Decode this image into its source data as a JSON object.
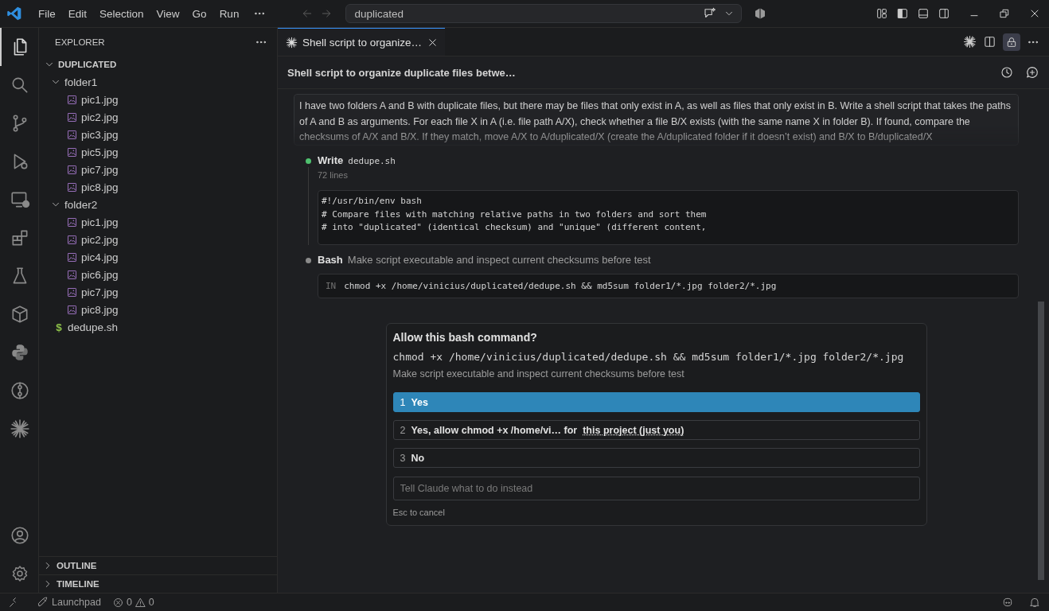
{
  "menu": [
    "File",
    "Edit",
    "Selection",
    "View",
    "Go",
    "Run"
  ],
  "command_center": {
    "text": "duplicated"
  },
  "activity_bar": [
    {
      "selected": true
    },
    {
      "selected": false
    },
    {
      "selected": false
    },
    {
      "selected": false
    },
    {
      "selected": false
    },
    {
      "selected": false
    },
    {
      "selected": false
    },
    {
      "selected": false
    },
    {
      "selected": false
    },
    {
      "selected": false
    },
    {
      "selected": false
    }
  ],
  "explorer": {
    "title": "EXPLORER",
    "tree": [
      {
        "label": "DUPLICATED",
        "kind": "root",
        "expanded": true,
        "children": [
          {
            "label": "folder1",
            "kind": "folder",
            "expanded": true,
            "children": [
              {
                "label": "pic1.jpg",
                "kind": "image"
              },
              {
                "label": "pic2.jpg",
                "kind": "image"
              },
              {
                "label": "pic3.jpg",
                "kind": "image"
              },
              {
                "label": "pic5.jpg",
                "kind": "image"
              },
              {
                "label": "pic7.jpg",
                "kind": "image"
              },
              {
                "label": "pic8.jpg",
                "kind": "image"
              }
            ]
          },
          {
            "label": "folder2",
            "kind": "folder",
            "expanded": true,
            "children": [
              {
                "label": "pic1.jpg",
                "kind": "image"
              },
              {
                "label": "pic2.jpg",
                "kind": "image"
              },
              {
                "label": "pic4.jpg",
                "kind": "image"
              },
              {
                "label": "pic6.jpg",
                "kind": "image"
              },
              {
                "label": "pic7.jpg",
                "kind": "image"
              },
              {
                "label": "pic8.jpg",
                "kind": "image"
              }
            ]
          },
          {
            "label": "dedupe.sh",
            "kind": "shell",
            "icon": "$"
          }
        ]
      }
    ],
    "sections": [
      {
        "label": "OUTLINE",
        "expanded": false
      },
      {
        "label": "TIMELINE",
        "expanded": false
      }
    ]
  },
  "tab": {
    "label": "Shell script to organize…",
    "selected": true
  },
  "chat": {
    "title": "Shell script to organize duplicate files betwe…",
    "prompt": "I have two folders A and B with duplicate files, but there may be files that only exist in A, as well as files that only exist in B. Write a shell script that takes the paths of A and B as arguments. For each file X in A (i.e. file path A/X), check whether a file B/X exists (with the same name X in folder B). If found, compare the checksums of A/X and B/X. If they match, move A/X to A/duplicated/X (create the A/duplicated folder if it doesn’t exist) and B/X to B/duplicated/X",
    "steps": [
      {
        "kind": "write",
        "color": "#4fc16f",
        "label": "Write",
        "file": "dedupe.sh",
        "meta": "72 lines",
        "code": [
          "#!/usr/bin/env bash",
          "# Compare files with matching relative paths in two folders and sort them",
          "# into \"duplicated\" (identical checksum) and \"unique\" (different content,"
        ]
      },
      {
        "kind": "bash",
        "color": "#8a8a8a",
        "label": "Bash",
        "description": "Make script executable and inspect current checksums before test",
        "in_label": "IN",
        "command": "chmod +x /home/vinicius/duplicated/dedupe.sh && md5sum folder1/*.jpg folder2/*.jpg"
      }
    ]
  },
  "permission": {
    "title": "Allow this bash command?",
    "command": "chmod +x /home/vinicius/duplicated/dedupe.sh && md5sum folder1/*.jpg folder2/*.jpg",
    "description": "Make script executable and inspect current checksums before test",
    "options": [
      {
        "number": "1",
        "label": "Yes",
        "selected": true
      },
      {
        "number": "2",
        "label": "Yes, allow chmod +x /home/vi… for",
        "link": "this project (just you)",
        "selected": false
      },
      {
        "number": "3",
        "label": "No",
        "selected": false
      }
    ],
    "input": {
      "placeholder": "Tell Claude what to do instead"
    },
    "hint": "Esc to cancel"
  },
  "status_bar": {
    "launchpad": "Launchpad",
    "errors": "0",
    "warnings": "0"
  }
}
